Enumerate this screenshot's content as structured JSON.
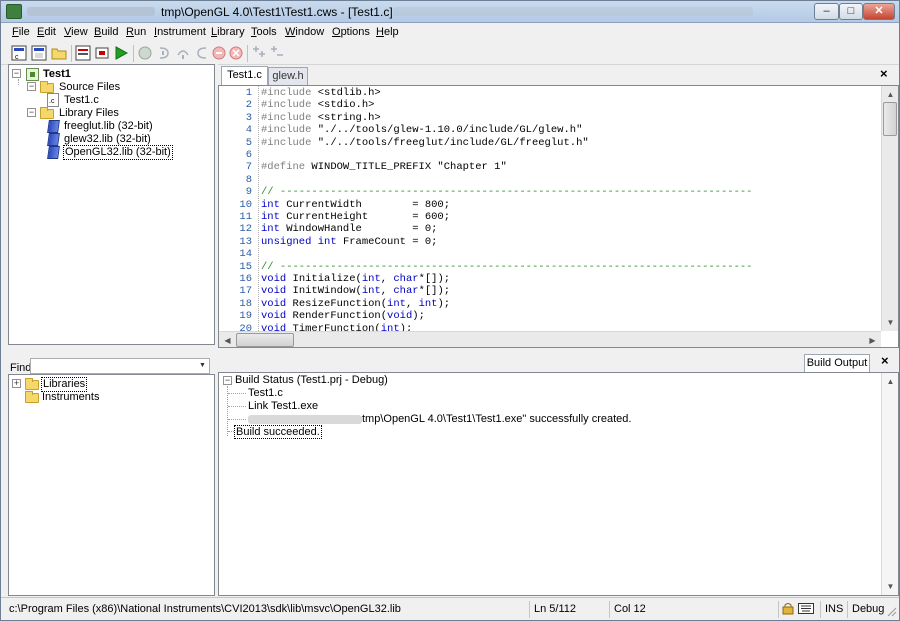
{
  "window": {
    "title": "tmp\\OpenGL 4.0\\Test1\\Test1.cws - [Test1.c]",
    "controls": {
      "minimize": "–",
      "maximize": "□",
      "close": "✕"
    }
  },
  "menu": [
    "File",
    "Edit",
    "View",
    "Build",
    "Run",
    "Instrument",
    "Library",
    "Tools",
    "Window",
    "Options",
    "Help"
  ],
  "toolbar": {
    "icons": [
      "new-project-icon",
      "new-file-icon",
      "open-icon",
      "build-icon",
      "debug-stop-icon",
      "run-icon",
      "breakpoint-icon",
      "step-into-icon",
      "step-over-icon",
      "step-out-icon",
      "stop-icon",
      "terminate-icon",
      "toggle-breakpoint-icon",
      "clear-breakpoint-icon"
    ],
    "run_color": "#1fa01f"
  },
  "project_tree": {
    "root": "Test1",
    "source_folder": "Source Files",
    "source_files": [
      "Test1.c"
    ],
    "library_folder": "Library Files",
    "library_files": [
      "freeglut.lib (32-bit)",
      "glew32.lib (32-bit)",
      "OpenGL32.lib (32-bit)"
    ],
    "selected": "OpenGL32.lib (32-bit)"
  },
  "find": {
    "label": "Find",
    "value": ""
  },
  "instrument_tree": {
    "items": [
      "Libraries",
      "Instruments"
    ]
  },
  "editor": {
    "tabs": [
      "Test1.c",
      "glew.h"
    ],
    "active_tab": "Test1.c",
    "lines": [
      {
        "n": "1",
        "text": "#include <stdlib.h>"
      },
      {
        "n": "2",
        "text": "#include <stdio.h>"
      },
      {
        "n": "3",
        "text": "#include <string.h>"
      },
      {
        "n": "4",
        "text": "#include \"./../tools/glew-1.10.0/include/GL/glew.h\""
      },
      {
        "n": "5",
        "text": "#include \"./../tools/freeglut/include/GL/freeglut.h\""
      },
      {
        "n": "6",
        "text": ""
      },
      {
        "n": "7",
        "text": "#define WINDOW_TITLE_PREFIX \"Chapter 1\""
      },
      {
        "n": "8",
        "text": ""
      },
      {
        "n": "9",
        "text": "// ---------------------------------------------------------------------------"
      },
      {
        "n": "10",
        "text": "int CurrentWidth        = 800;"
      },
      {
        "n": "11",
        "text": "int CurrentHeight       = 600;"
      },
      {
        "n": "12",
        "text": "int WindowHandle        = 0;"
      },
      {
        "n": "13",
        "text": "unsigned int FrameCount = 0;"
      },
      {
        "n": "14",
        "text": ""
      },
      {
        "n": "15",
        "text": "// ---------------------------------------------------------------------------"
      },
      {
        "n": "16",
        "text": "void Initialize(int, char*[]);"
      },
      {
        "n": "17",
        "text": "void InitWindow(int, char*[]);"
      },
      {
        "n": "18",
        "text": "void ResizeFunction(int, int);"
      },
      {
        "n": "19",
        "text": "void RenderFunction(void);"
      },
      {
        "n": "20",
        "text": "void TimerFunction(int);"
      }
    ]
  },
  "build_output": {
    "tab_label": "Build Output",
    "status_header": "Build Status (Test1.prj - Debug)",
    "items": [
      "Test1.c",
      "Link Test1.exe"
    ],
    "created_suffix": "tmp\\OpenGL 4.0\\Test1\\Test1.exe\" successfully created.",
    "result": "Build succeeded."
  },
  "statusbar": {
    "path": "c:\\Program Files (x86)\\National Instruments\\CVI2013\\sdk\\lib\\msvc\\OpenGL32.lib",
    "line": "Ln 5/112",
    "col": "Col 12",
    "mode": "INS",
    "config": "Debug"
  }
}
